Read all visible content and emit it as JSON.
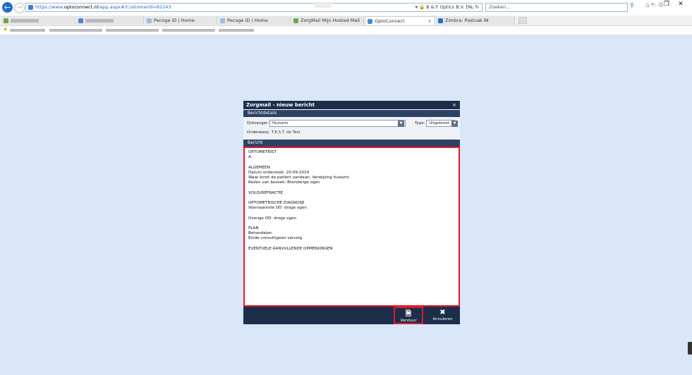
{
  "browser": {
    "url_prefix": "https://www.",
    "url_host": "optoconnect.nl",
    "url_path": "/app.aspx#/CustomerId=82243",
    "address_tools": "▾ 🔒 B & F Optics B.V. [NL ↻",
    "search_placeholder": "Zoeken...",
    "window_controls": [
      "–",
      "❐",
      "✕"
    ],
    "tabs": [
      {
        "label": "",
        "blurred": true
      },
      {
        "label": "",
        "blurred": true
      },
      {
        "label": "Pecoge ID | Home"
      },
      {
        "label": "Pecoge ID | Home"
      },
      {
        "label": "ZorgMail Mijn Hosted Mail"
      },
      {
        "label": "OptoConnect",
        "active": true
      },
      {
        "label": "Zimbra: Postvak IN"
      }
    ]
  },
  "modal": {
    "title": "Zorgmail - nieuw bericht",
    "close": "×",
    "details_header": "Berichtdetails",
    "ontvanger_label": "Ontvanger:",
    "ontvanger_value": "Huisarts",
    "type_label": "Type:",
    "type_value": "Uitgebreid",
    "onderwerp_label": "Onderwerp:",
    "onderwerp_value": "T.E.S.T. de Test",
    "message_header": "Bericht",
    "message_lines": [
      "OPTOMETRIST",
      "A.",
      "",
      "ALGEMEEN",
      "Datum onderzoek: 20-09-2019",
      "Waar komt de patiënt vandaan: Verwijzing huisarts",
      "Reden van bezoek: Brenderige ogen",
      "",
      "VISUS/REFRACTIE",
      "",
      "OPTOMETRISCHE DIAGNOSE",
      "Voornaamste OD: droge ogen",
      "",
      "Overige OD: droge ogen",
      "",
      "PLAN",
      "Behandelen",
      "Einde consult/geen vervolg",
      "",
      "EVENTUELE AANVULLENDE OPMERKINGEN"
    ],
    "send_label": "Verstuur",
    "cancel_label": "Annuleren"
  },
  "icons": {
    "back": "back-arrow-icon",
    "forward": "forward-arrow-icon",
    "send": "send-document-icon",
    "cancel": "close-x-icon"
  },
  "colors": {
    "page_bg": "#d9e7f8",
    "modal_header": "#1c2e4a",
    "section_header": "#2c4163",
    "highlight": "#e01a2c",
    "browser_accent": "#1f6fc7"
  }
}
